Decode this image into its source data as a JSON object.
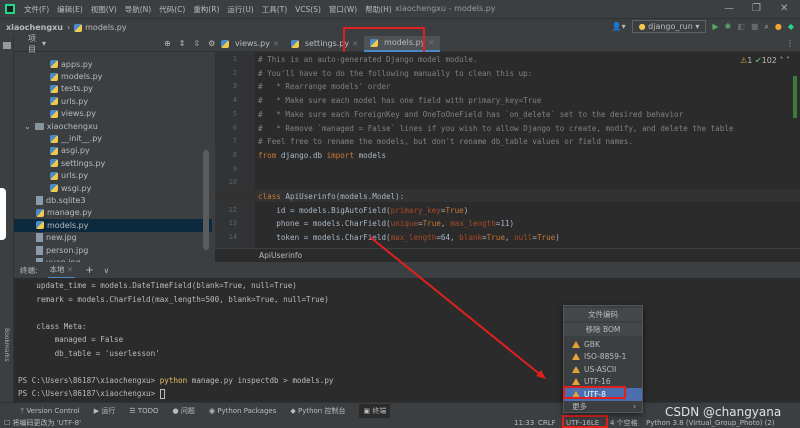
{
  "menubar": {
    "items": [
      "文件(F)",
      "编辑(E)",
      "视图(V)",
      "导航(N)",
      "代码(C)",
      "重构(R)",
      "运行(U)",
      "工具(T)",
      "VCS(S)",
      "窗口(W)",
      "帮助(H)"
    ],
    "title": "xiaochengxu - models.py"
  },
  "navbar": {
    "project": "xiaochengxu",
    "file": "models.py",
    "run_config": "django_run"
  },
  "project": {
    "title": "项目",
    "items": [
      {
        "label": "apps.py",
        "type": "py",
        "indent": 3
      },
      {
        "label": "models.py",
        "type": "py",
        "indent": 3
      },
      {
        "label": "tests.py",
        "type": "py",
        "indent": 3
      },
      {
        "label": "urls.py",
        "type": "py",
        "indent": 3
      },
      {
        "label": "views.py",
        "type": "py",
        "indent": 3
      },
      {
        "label": "xiaochengxu",
        "type": "folder",
        "indent": 2
      },
      {
        "label": "__init__.py",
        "type": "py",
        "indent": 3
      },
      {
        "label": "asgi.py",
        "type": "py",
        "indent": 3
      },
      {
        "label": "settings.py",
        "type": "py",
        "indent": 3
      },
      {
        "label": "urls.py",
        "type": "py",
        "indent": 3
      },
      {
        "label": "wsgi.py",
        "type": "py",
        "indent": 3
      },
      {
        "label": "db.sqlite3",
        "type": "file",
        "indent": 2
      },
      {
        "label": "manage.py",
        "type": "py",
        "indent": 2
      },
      {
        "label": "models.py",
        "type": "py",
        "indent": 2,
        "selected": true
      },
      {
        "label": "new.jpg",
        "type": "file",
        "indent": 2
      },
      {
        "label": "person.jpg",
        "type": "file",
        "indent": 2
      },
      {
        "label": "yuan.jpg",
        "type": "file",
        "indent": 2
      }
    ]
  },
  "tabs": [
    "views.py",
    "settings.py",
    "models.py"
  ],
  "inspection": {
    "warnings": "1",
    "ok": "102"
  },
  "editor": {
    "lines": [
      {
        "n": "1",
        "html": "<span class='cm'># This is an auto-generated Django model module.</span>"
      },
      {
        "n": "2",
        "html": "<span class='cm'># You'll have to do the following manually to clean this up:</span>"
      },
      {
        "n": "3",
        "html": "<span class='cm'>#   * Rearrange models' order</span>"
      },
      {
        "n": "4",
        "html": "<span class='cm'>#   * Make sure each model has one field with primary_key=True</span>"
      },
      {
        "n": "5",
        "html": "<span class='cm'>#   * Make sure each ForeignKey and OneToOneField has `on_delete` set to the desired behavior</span>"
      },
      {
        "n": "6",
        "html": "<span class='cm'>#   * Remove `managed = False` lines if you wish to allow Django to create, modify, and delete the table</span>"
      },
      {
        "n": "7",
        "html": "<span class='cm'># Feel free to rename the models, but don't rename db_table values or field names.</span>"
      },
      {
        "n": "8",
        "html": "<span class='kw'>from</span> django.db <span class='kw'>import</span> models"
      },
      {
        "n": "9",
        "html": ""
      },
      {
        "n": "10",
        "html": ""
      },
      {
        "n": "11",
        "html": "<span class='kw'>class</span> ApiUserinfo(models.Model):"
      },
      {
        "n": "12",
        "html": "    id = models.BigAutoField(<span class='pm'>primary_key</span>=<span class='kw'>True</span>)"
      },
      {
        "n": "13",
        "html": "    phone = models.CharField(<span class='pm'>unique</span>=<span class='kw'>True</span>, <span class='pm'>max_length</span>=11)"
      },
      {
        "n": "14",
        "html": "    token = models.CharField(<span class='pm'>max_length</span>=64, <span class='pm'>blank</span>=<span class='kw'>True</span>, <span class='pm'>null</span>=<span class='kw'>True</span>)"
      }
    ],
    "breadcrumb": "ApiUserinfo"
  },
  "terminal": {
    "title": "终端:",
    "tab": "本地",
    "lines": [
      "    update_time = models.DateTimeField(blank=True, null=True)",
      "    remark = models.CharField(max_length=500, blank=True, null=True)",
      "",
      "    class Meta:",
      "        managed = False",
      "        db_table = 'userlesson'"
    ],
    "prompt": "PS C:\\Users\\86187\\xiaochengxu> ",
    "cmd_kw": "python",
    "cmd_rest": " manage.py inspectdb > models.py"
  },
  "bottombar": [
    "Version Control",
    "运行",
    "TODO",
    "问题",
    "Python Packages",
    "Python 控制台",
    "终端"
  ],
  "status": {
    "message": "将编码更改为 'UTF-8'",
    "position": "11:33",
    "line_sep": "CRLF",
    "encoding": "UTF-16LE",
    "indent": "4 个空格",
    "interpreter": "Python 3.8 (Virtual_Group_Photo) (2)"
  },
  "popup": {
    "title": "文件编码",
    "remove_bom": "移除 BOM",
    "items": [
      "GBK",
      "ISO-8859-1",
      "US-ASCII",
      "UTF-16",
      "UTF-8"
    ],
    "selected": "UTF-8",
    "more": "更多"
  },
  "watermark": "CSDN @changyana",
  "colors": {
    "accent": "#4b6eaf",
    "highlight": "#e0201f"
  }
}
